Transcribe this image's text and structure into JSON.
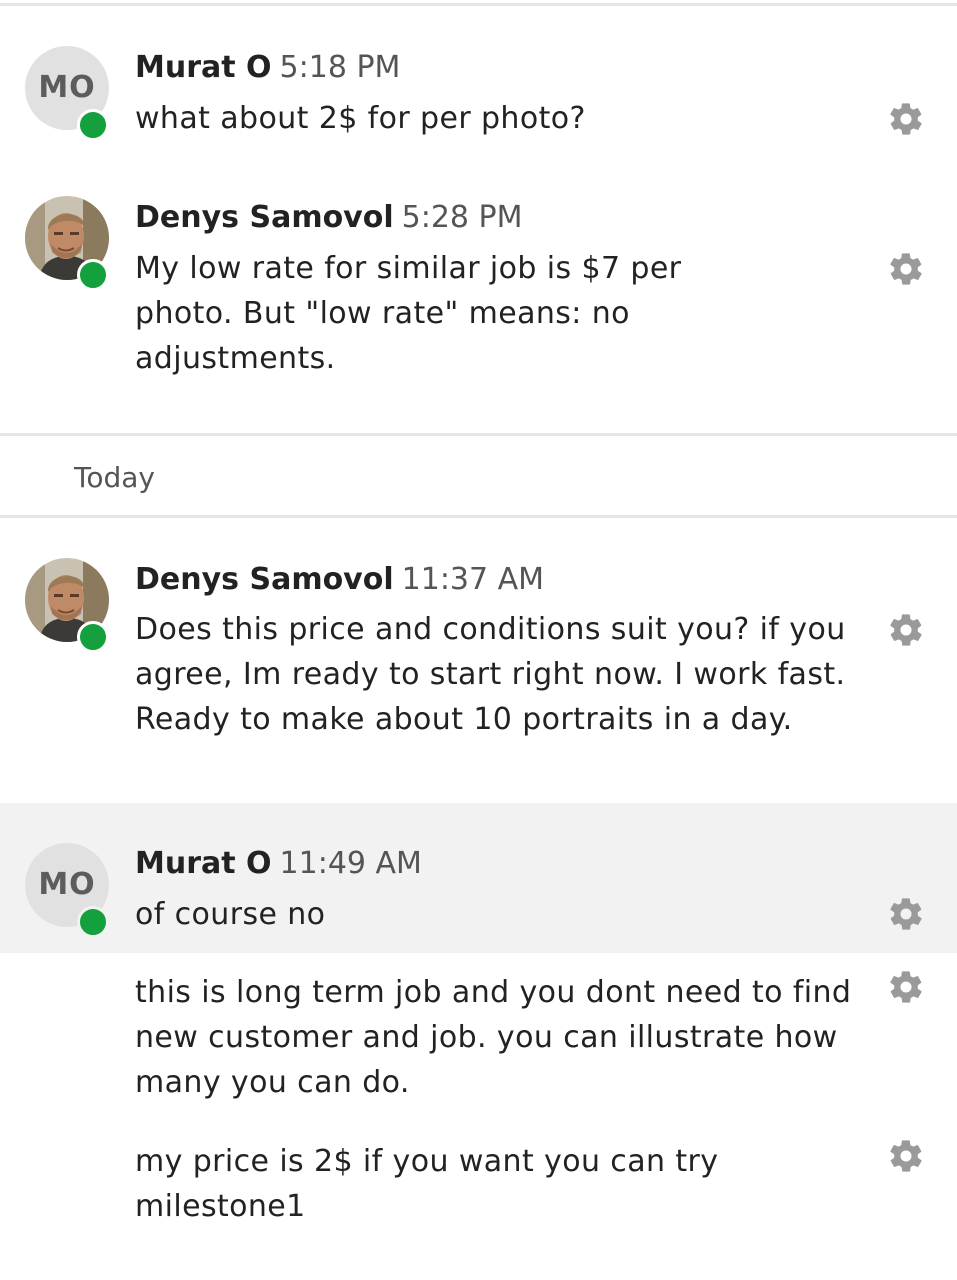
{
  "separator": {
    "label": "Today"
  },
  "messages": [
    {
      "author": "Murat O",
      "initials": "MO",
      "time": "5:18 PM",
      "text": "what about 2$ for per photo?"
    },
    {
      "author": "Denys Samovol",
      "time": "5:28 PM",
      "text": "My low rate for similar job is $7 per photo. But \"low rate\" means: no adjustments."
    },
    {
      "author": "Denys Samovol",
      "time": "11:37 AM",
      "text": "Does this price and conditions suit you? if you agree, Im ready to start right now. I work fast. Ready to make about 10 portraits in a day."
    },
    {
      "author": "Murat O",
      "initials": "MO",
      "time": "11:49 AM",
      "text": "of course no"
    },
    {
      "text": "this is long term job and you dont need to find new customer and job. you can illustrate how many you can do."
    },
    {
      "text": "my price is 2$ if you want you can try milestone1"
    }
  ],
  "colors": {
    "online": "#14a03c",
    "highlight_bg": "#f2f2f2",
    "avatar_bg": "#e1e1e1"
  },
  "icons": {
    "message_settings": "gear-icon",
    "status": "online-status-dot"
  }
}
